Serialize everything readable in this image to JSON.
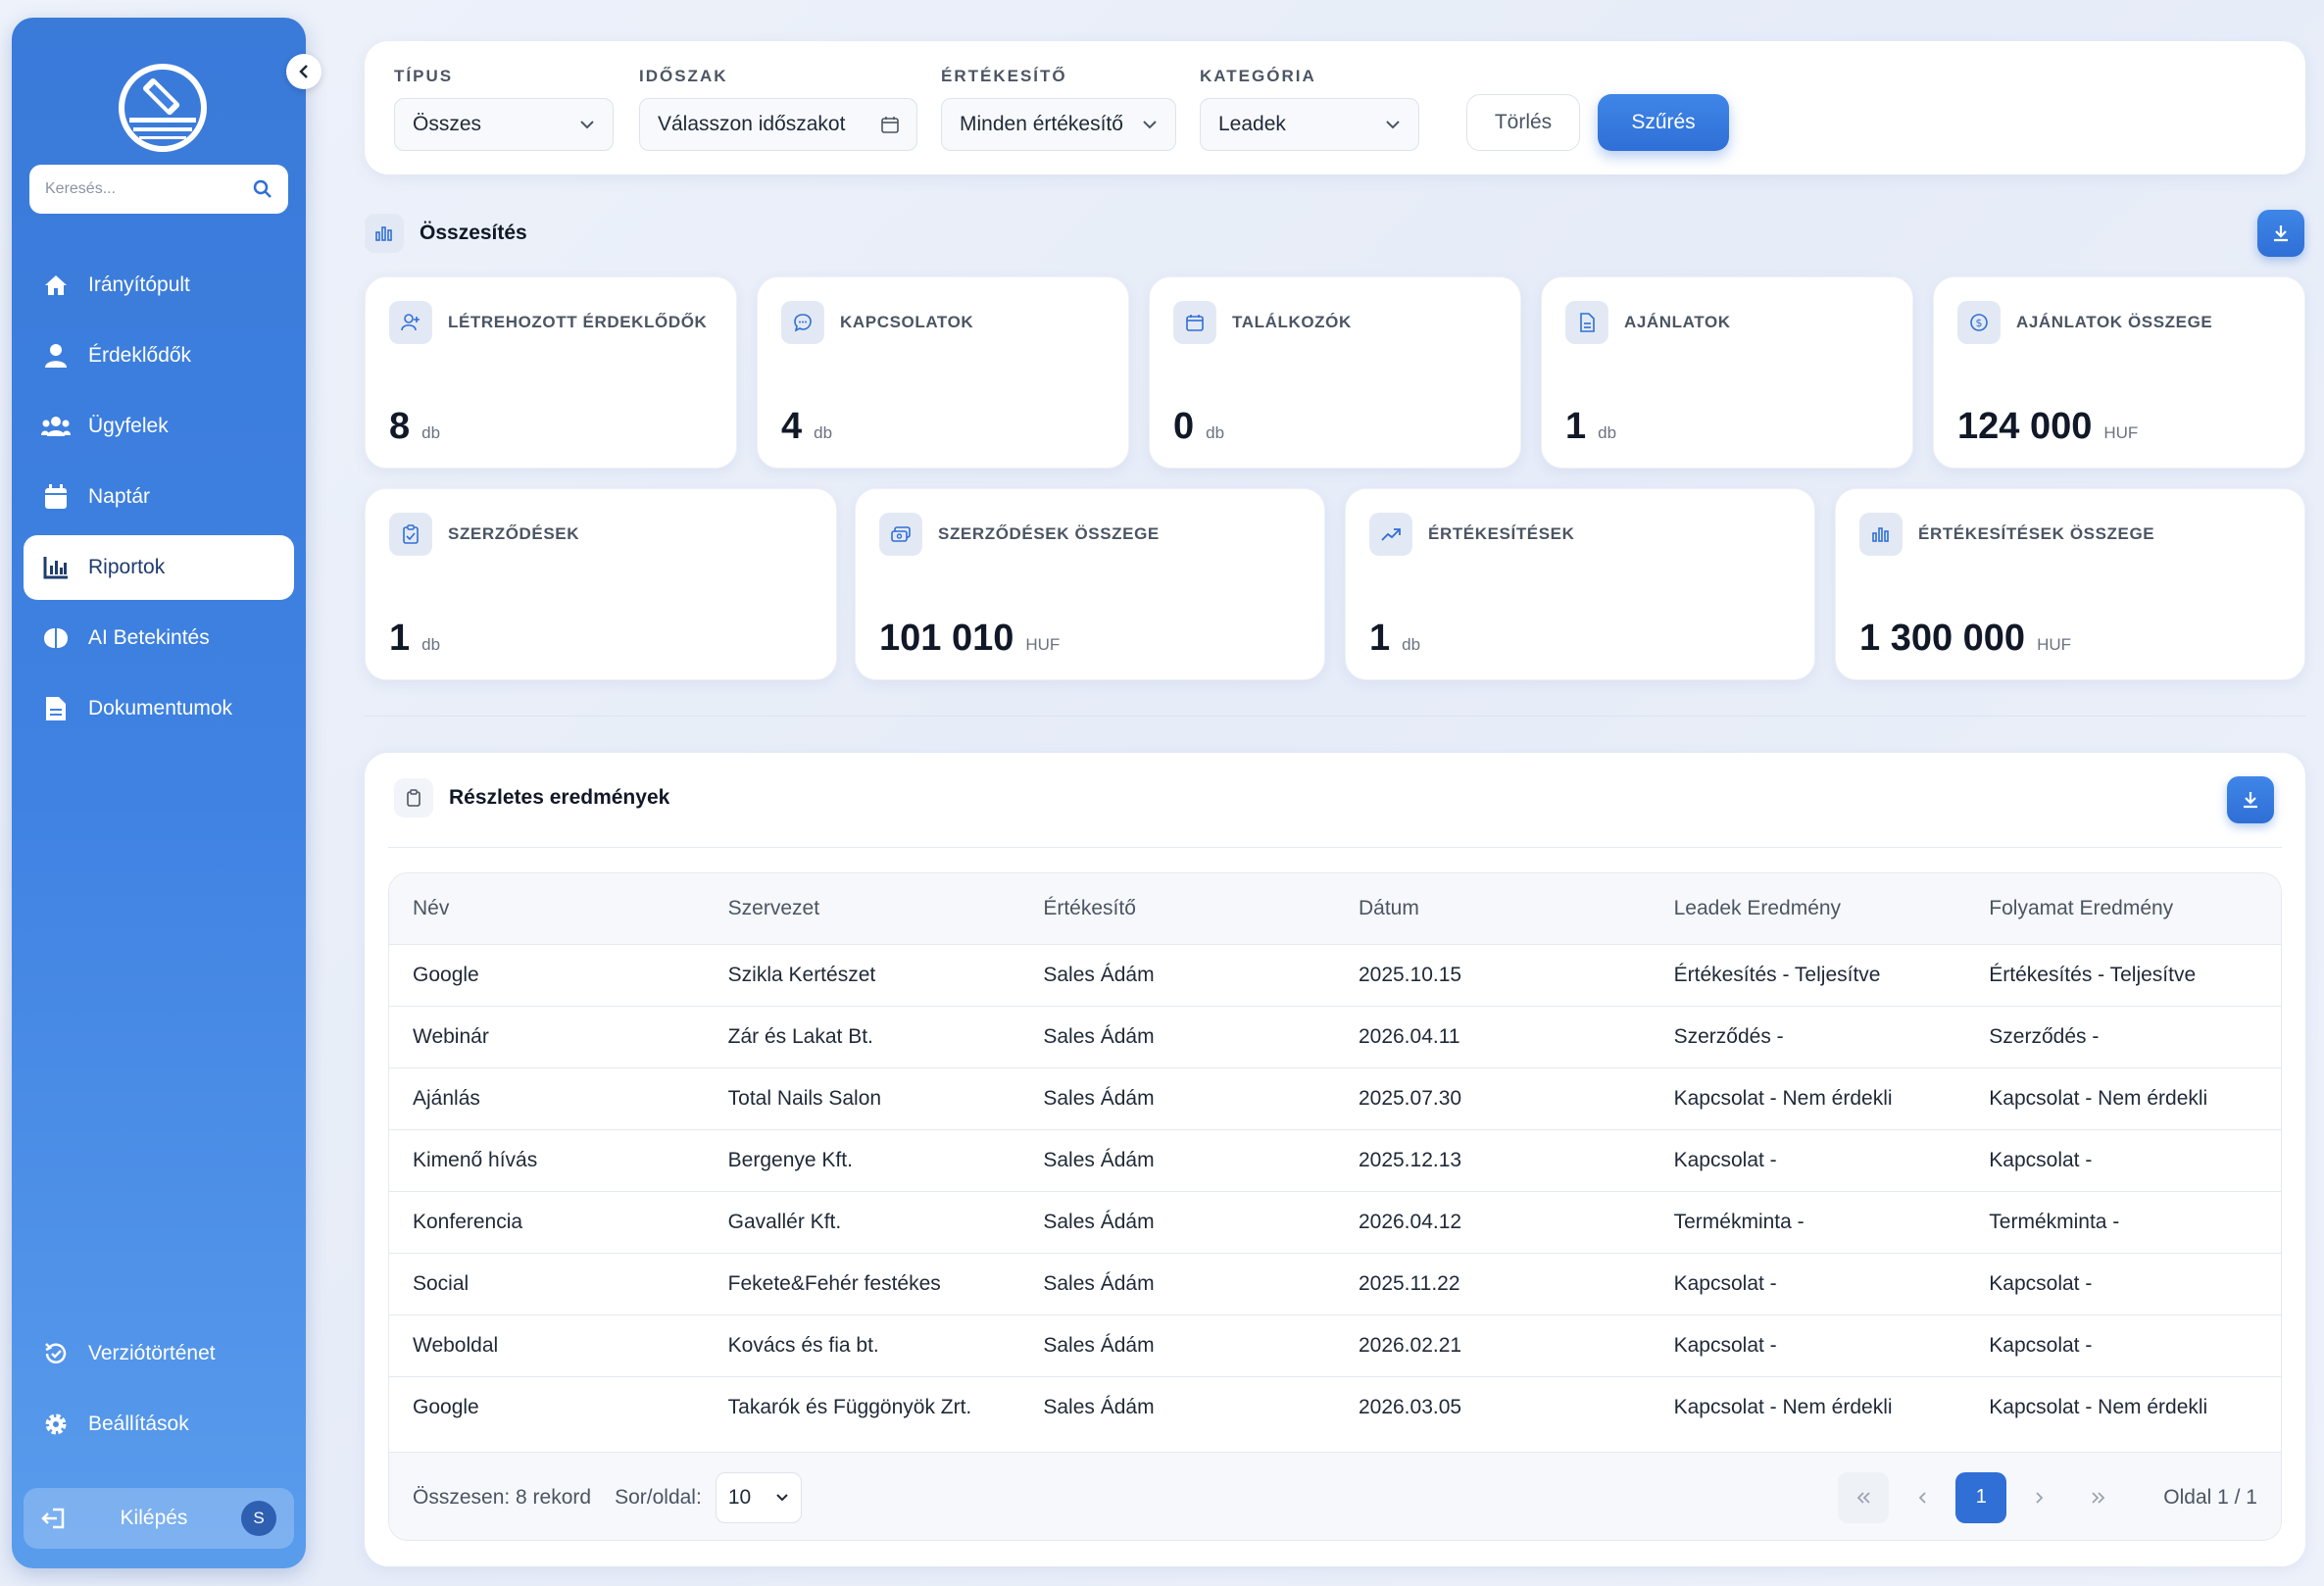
{
  "sidebar": {
    "search_placeholder": "Keresés...",
    "items": [
      {
        "label": "Irányítópult",
        "icon": "home-icon"
      },
      {
        "label": "Érdeklődők",
        "icon": "user-icon"
      },
      {
        "label": "Ügyfelek",
        "icon": "users-icon"
      },
      {
        "label": "Naptár",
        "icon": "calendar-icon"
      },
      {
        "label": "Riportok",
        "icon": "chart-icon",
        "active": true
      },
      {
        "label": "AI Betekintés",
        "icon": "brain-icon"
      },
      {
        "label": "Dokumentumok",
        "icon": "document-icon"
      }
    ],
    "bottom_items": [
      {
        "label": "Verziótörténet",
        "icon": "history-icon"
      },
      {
        "label": "Beállítások",
        "icon": "gear-icon"
      }
    ],
    "logout_label": "Kilépés",
    "avatar_letter": "S"
  },
  "filters": {
    "type_label": "TÍPUS",
    "type_value": "Összes",
    "period_label": "IDŐSZAK",
    "period_value": "Válasszon időszakot",
    "seller_label": "ÉRTÉKESÍTŐ",
    "seller_value": "Minden értékesítő",
    "category_label": "KATEGÓRIA",
    "category_value": "Leadek",
    "clear_label": "Törlés",
    "filter_label": "Szűrés"
  },
  "summary": {
    "title": "Összesítés",
    "cards_row1": [
      {
        "title": "LÉTREHOZOTT ÉRDEKLŐDŐK",
        "value": "8",
        "unit": "db",
        "icon": "user-plus-icon"
      },
      {
        "title": "KAPCSOLATOK",
        "value": "4",
        "unit": "db",
        "icon": "chat-icon"
      },
      {
        "title": "TALÁLKOZÓK",
        "value": "0",
        "unit": "db",
        "icon": "calendar-icon"
      },
      {
        "title": "AJÁNLATOK",
        "value": "1",
        "unit": "db",
        "icon": "file-icon"
      },
      {
        "title": "AJÁNLATOK ÖSSZEGE",
        "value": "124 000",
        "unit": "HUF",
        "icon": "coin-icon"
      }
    ],
    "cards_row2": [
      {
        "title": "SZERZŐDÉSEK",
        "value": "1",
        "unit": "db",
        "icon": "clipboard-icon"
      },
      {
        "title": "SZERZŐDÉSEK ÖSSZEGE",
        "value": "101 010",
        "unit": "HUF",
        "icon": "money-icon"
      },
      {
        "title": "ÉRTÉKESÍTÉSEK",
        "value": "1",
        "unit": "db",
        "icon": "trend-icon"
      },
      {
        "title": "ÉRTÉKESÍTÉSEK ÖSSZEGE",
        "value": "1 300 000",
        "unit": "HUF",
        "icon": "bar-chart-icon"
      }
    ]
  },
  "details": {
    "title": "Részletes eredmények",
    "columns": [
      "Név",
      "Szervezet",
      "Értékesítő",
      "Dátum",
      "Leadek Eredmény",
      "Folyamat Eredmény"
    ],
    "rows": [
      [
        "Google",
        "Szikla Kertészet",
        "Sales Ádám",
        "2025.10.15",
        "Értékesítés - Teljesítve",
        "Értékesítés - Teljesítve"
      ],
      [
        "Webinár",
        "Zár és Lakat Bt.",
        "Sales Ádám",
        "2026.04.11",
        "Szerződés -",
        "Szerződés -"
      ],
      [
        "Ajánlás",
        "Total Nails Salon",
        "Sales Ádám",
        "2025.07.30",
        "Kapcsolat - Nem érdekli",
        "Kapcsolat - Nem érdekli"
      ],
      [
        "Kimenő hívás",
        "Bergenye Kft.",
        "Sales Ádám",
        "2025.12.13",
        "Kapcsolat -",
        "Kapcsolat -"
      ],
      [
        "Konferencia",
        "Gavallér Kft.",
        "Sales Ádám",
        "2026.04.12",
        "Termékminta -",
        "Termékminta -"
      ],
      [
        "Social",
        "Fekete&Fehér festékes",
        "Sales Ádám",
        "2025.11.22",
        "Kapcsolat -",
        "Kapcsolat -"
      ],
      [
        "Weboldal",
        "Kovács és fia bt.",
        "Sales Ádám",
        "2026.02.21",
        "Kapcsolat -",
        "Kapcsolat -"
      ],
      [
        "Google",
        "Takarók és Függönyök Zrt.",
        "Sales Ádám",
        "2026.03.05",
        "Kapcsolat - Nem érdekli",
        "Kapcsolat - Nem érdekli"
      ]
    ],
    "total_label": "Összesen: 8 rekord",
    "per_page_label": "Sor/oldal:",
    "per_page_value": "10",
    "current_page": "1",
    "page_info": "Oldal 1 / 1"
  },
  "colors": {
    "accent": "#2f6fd6",
    "sidebar": "#3f82e2"
  }
}
